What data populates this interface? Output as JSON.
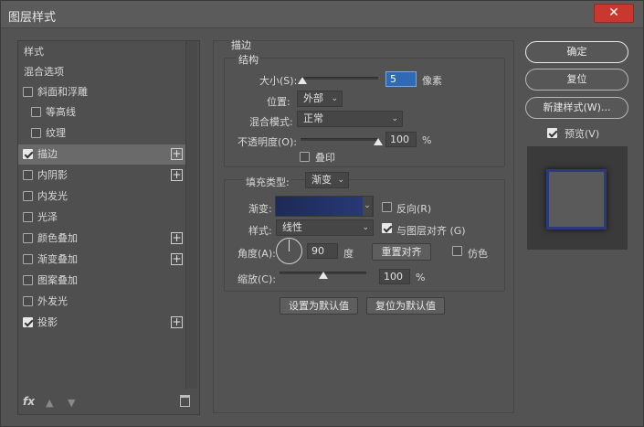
{
  "window": {
    "title": "图层样式",
    "close_icon": "✕"
  },
  "style_list": {
    "header_items": [
      {
        "label": "样式"
      },
      {
        "label": "混合选项"
      }
    ],
    "items": [
      {
        "label": "斜面和浮雕",
        "checked": false,
        "plus": false,
        "indent": false,
        "selected": false
      },
      {
        "label": "等高线",
        "checked": false,
        "plus": false,
        "indent": true,
        "selected": false
      },
      {
        "label": "纹理",
        "checked": false,
        "plus": false,
        "indent": true,
        "selected": false
      },
      {
        "label": "描边",
        "checked": true,
        "plus": true,
        "indent": false,
        "selected": true
      },
      {
        "label": "内阴影",
        "checked": false,
        "plus": true,
        "indent": false,
        "selected": false
      },
      {
        "label": "内发光",
        "checked": false,
        "plus": false,
        "indent": false,
        "selected": false
      },
      {
        "label": "光泽",
        "checked": false,
        "plus": false,
        "indent": false,
        "selected": false
      },
      {
        "label": "颜色叠加",
        "checked": false,
        "plus": true,
        "indent": false,
        "selected": false
      },
      {
        "label": "渐变叠加",
        "checked": false,
        "plus": true,
        "indent": false,
        "selected": false
      },
      {
        "label": "图案叠加",
        "checked": false,
        "plus": false,
        "indent": false,
        "selected": false
      },
      {
        "label": "外发光",
        "checked": false,
        "plus": false,
        "indent": false,
        "selected": false
      },
      {
        "label": "投影",
        "checked": true,
        "plus": true,
        "indent": false,
        "selected": false
      }
    ],
    "footer": {
      "fx": "fx",
      "up_icon": "▲",
      "down_icon": "▼"
    }
  },
  "stroke": {
    "section_title": "描边",
    "structure_title": "结构",
    "size_label": "大小(S):",
    "size_value": "5",
    "size_unit": "像素",
    "position_label": "位置:",
    "position_value": "外部",
    "blend_label": "混合模式:",
    "blend_value": "正常",
    "opacity_label": "不透明度(O):",
    "opacity_value": "100",
    "opacity_unit": "%",
    "overprint_label": "叠印",
    "fill_type_label": "填充类型:",
    "fill_type_value": "渐变",
    "gradient_label": "渐变:",
    "reverse_label": "反向(R)",
    "style_label": "样式:",
    "style_value": "线性",
    "align_label": "与图层对齐 (G)",
    "angle_label": "角度(A):",
    "angle_value": "90",
    "angle_unit": "度",
    "reset_align_button": "重置对齐",
    "dither_label": "仿色",
    "scale_label": "缩放(C):",
    "scale_value": "100",
    "scale_unit": "%",
    "set_default_button": "设置为默认值",
    "reset_default_button": "复位为默认值",
    "size_slider_fraction": 0.02,
    "opacity_slider_fraction": 1.0,
    "scale_slider_fraction": 0.5
  },
  "actions": {
    "ok": "确定",
    "reset": "复位",
    "new_style": "新建样式(W)...",
    "preview_label": "预览(V)"
  },
  "colors": {
    "gradient_start": "#1d2a55",
    "gradient_end": "#283a7a",
    "close_button": "#c8382e"
  }
}
